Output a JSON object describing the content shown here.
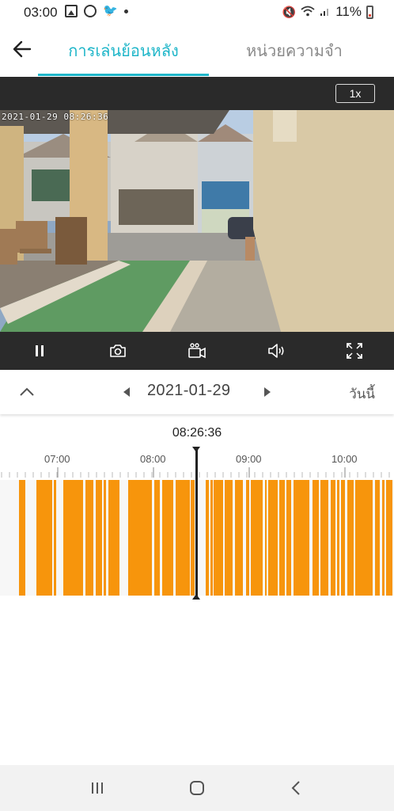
{
  "status_bar": {
    "time": "03:00",
    "battery": "11%",
    "icons": [
      "gallery-icon",
      "sync-icon",
      "twitter-icon",
      "dot-icon",
      "mute-icon",
      "wifi-icon",
      "signal-icon",
      "battery-icon"
    ]
  },
  "header": {
    "tabs": [
      {
        "label": "การเล่นย้อนหลัง",
        "active": true
      },
      {
        "label": "หน่วยความจำ",
        "active": false
      }
    ],
    "accent_color": "#1fb6c9"
  },
  "player": {
    "speed": "1x",
    "osd_timestamp": "2021-01-29 08:26:36"
  },
  "date_nav": {
    "date": "2021-01-29",
    "today_label": "วันนี้"
  },
  "timeline": {
    "current_time": "08:26:36",
    "hours": [
      "07:00",
      "08:00",
      "09:00",
      "10:00"
    ],
    "recording_color": "#f7950c"
  }
}
